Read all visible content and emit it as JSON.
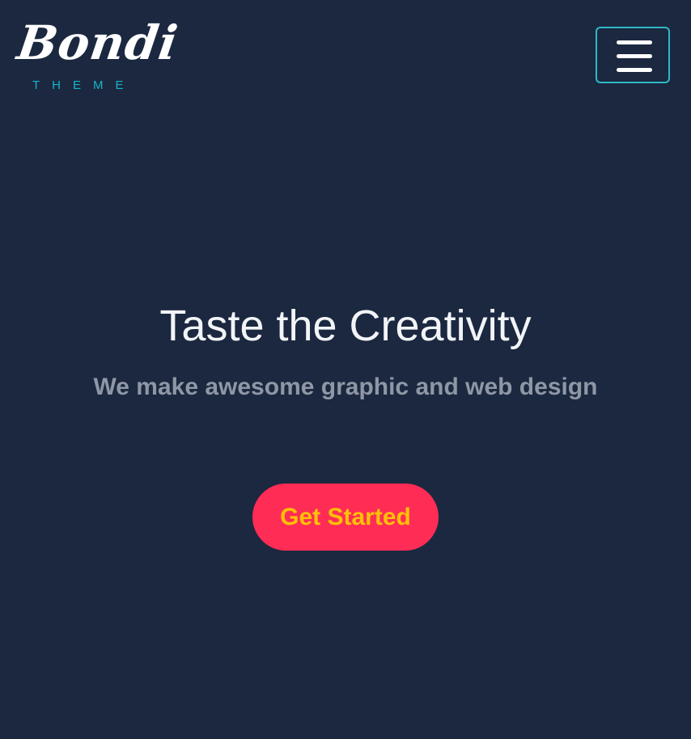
{
  "header": {
    "logo": {
      "script_text": "Bondi",
      "sub_text": "THEME"
    },
    "menu_button": {
      "icon": "hamburger-menu-icon"
    }
  },
  "hero": {
    "title": "Taste the Creativity",
    "subtitle": "We make awesome graphic and web design",
    "cta_label": "Get Started"
  },
  "colors": {
    "background": "#1b2840",
    "accent_teal": "#2fb8c4",
    "logo_sub": "#17b5c7",
    "cta_background": "#ff2d55",
    "cta_text": "#ffc107",
    "title": "#f2f4f7",
    "subtitle": "#8f97a6"
  }
}
